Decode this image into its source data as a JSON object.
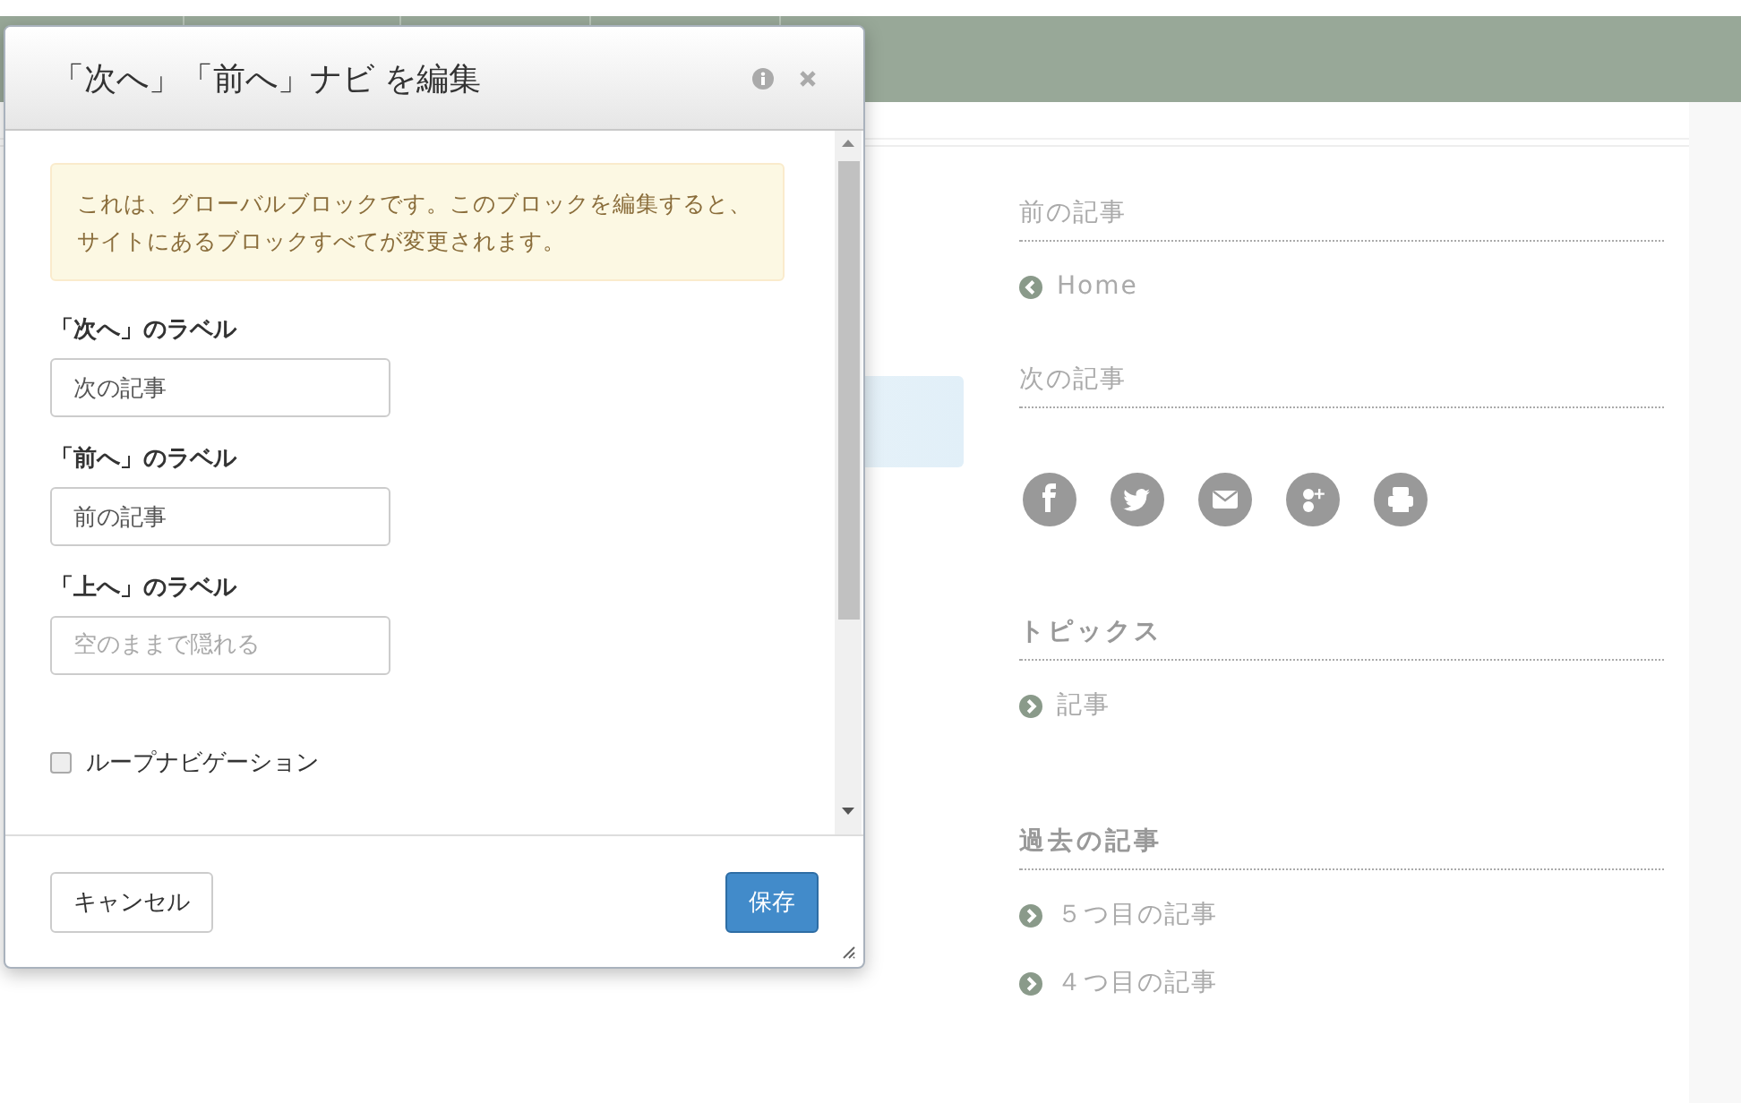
{
  "modal": {
    "title": "「次へ」「前へ」ナビ を編集",
    "notice": "これは、グローバルブロックです。このブロックを編集すると、サイトにあるブロックすべてが変更されます。",
    "fields": [
      {
        "label": "「次へ」のラベル",
        "value": "次の記事"
      },
      {
        "label": "「前へ」のラベル",
        "value": "前の記事"
      },
      {
        "label": "「上へ」のラベル",
        "placeholder": "空のままで隠れる"
      }
    ],
    "checkbox": {
      "label": "ループナビゲーション",
      "checked": false
    },
    "buttons": [
      {
        "kind": "default",
        "label": "キャンセル"
      },
      {
        "kind": "primary",
        "label": "保存"
      }
    ]
  },
  "sidebar": {
    "sections": [
      {
        "kind": "pager",
        "heading": "前の記事",
        "links": [
          {
            "text": "Home",
            "kind": "back"
          }
        ]
      },
      {
        "kind": "pager",
        "heading": "次の記事"
      },
      {
        "kind": "share"
      },
      {
        "kind": "widget",
        "heading": "トピックス",
        "links": [
          {
            "text": "記事",
            "kind": "forward"
          }
        ]
      },
      {
        "kind": "widget",
        "heading": "過去の記事",
        "links": [
          {
            "text": "５つ目の記事",
            "kind": "forward"
          },
          {
            "text": "４つ目の記事",
            "kind": "forward"
          }
        ]
      }
    ]
  }
}
